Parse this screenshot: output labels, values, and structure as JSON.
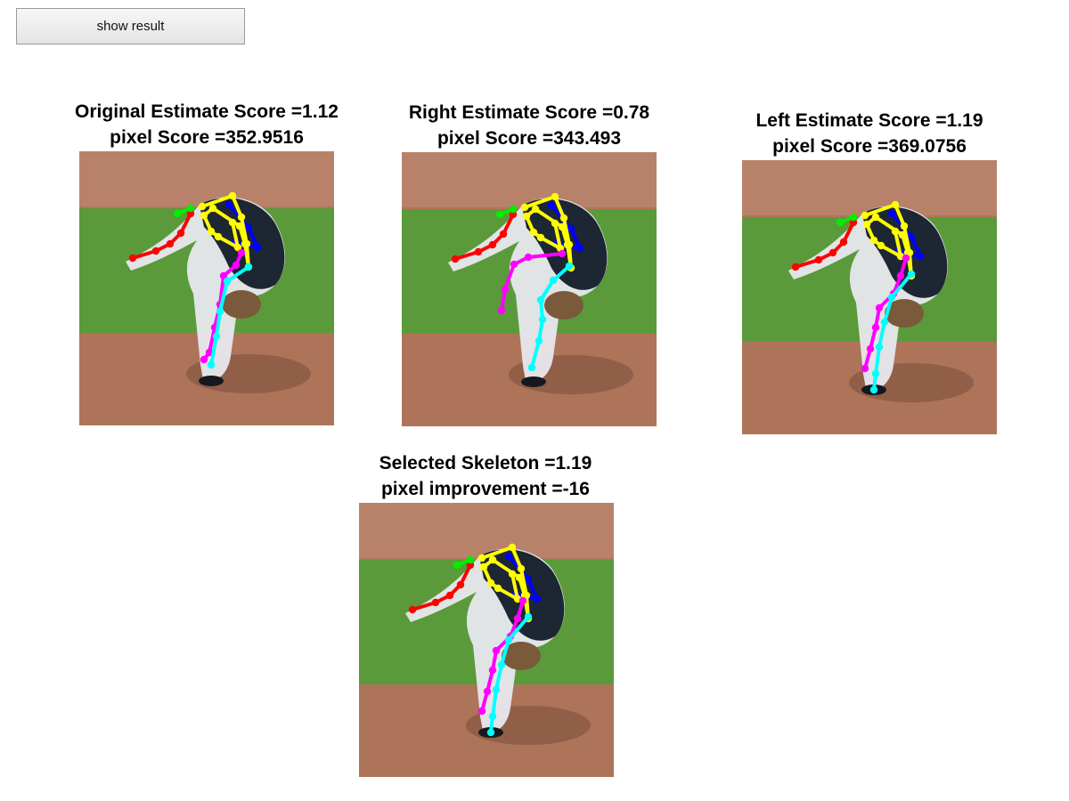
{
  "toolbar": {
    "show_result_label": "show result"
  },
  "panels": [
    {
      "id": "original",
      "title_line1": "Original Estimate Score =1.12",
      "title_line2": "pixel Score =352.9516",
      "image": "baseball-pitcher-photo",
      "skeleton_variant": "original"
    },
    {
      "id": "right",
      "title_line1": "Right Estimate Score =0.78",
      "title_line2": "pixel Score =343.493",
      "image": "baseball-pitcher-photo",
      "skeleton_variant": "right"
    },
    {
      "id": "left",
      "title_line1": "Left Estimate Score =1.19",
      "title_line2": "pixel Score =369.0756",
      "image": "baseball-pitcher-photo",
      "skeleton_variant": "left"
    },
    {
      "id": "selected",
      "title_line1": "Selected Skeleton =1.19",
      "title_line2": "pixel improvement =-16",
      "image": "baseball-pitcher-photo",
      "skeleton_variant": "left"
    }
  ],
  "skeleton_colors": {
    "right_arm": "#ff0000",
    "head": "#00ee00",
    "torso": "#ffff00",
    "left_arm": "#0000ff",
    "right_leg": "#ff00ff",
    "left_leg": "#00ffff"
  },
  "photo_colors": {
    "dirt": "#b0765a",
    "grass": "#5a9a3a",
    "uniform_dark": "#1d2633",
    "pants": "#e8e8ee"
  }
}
